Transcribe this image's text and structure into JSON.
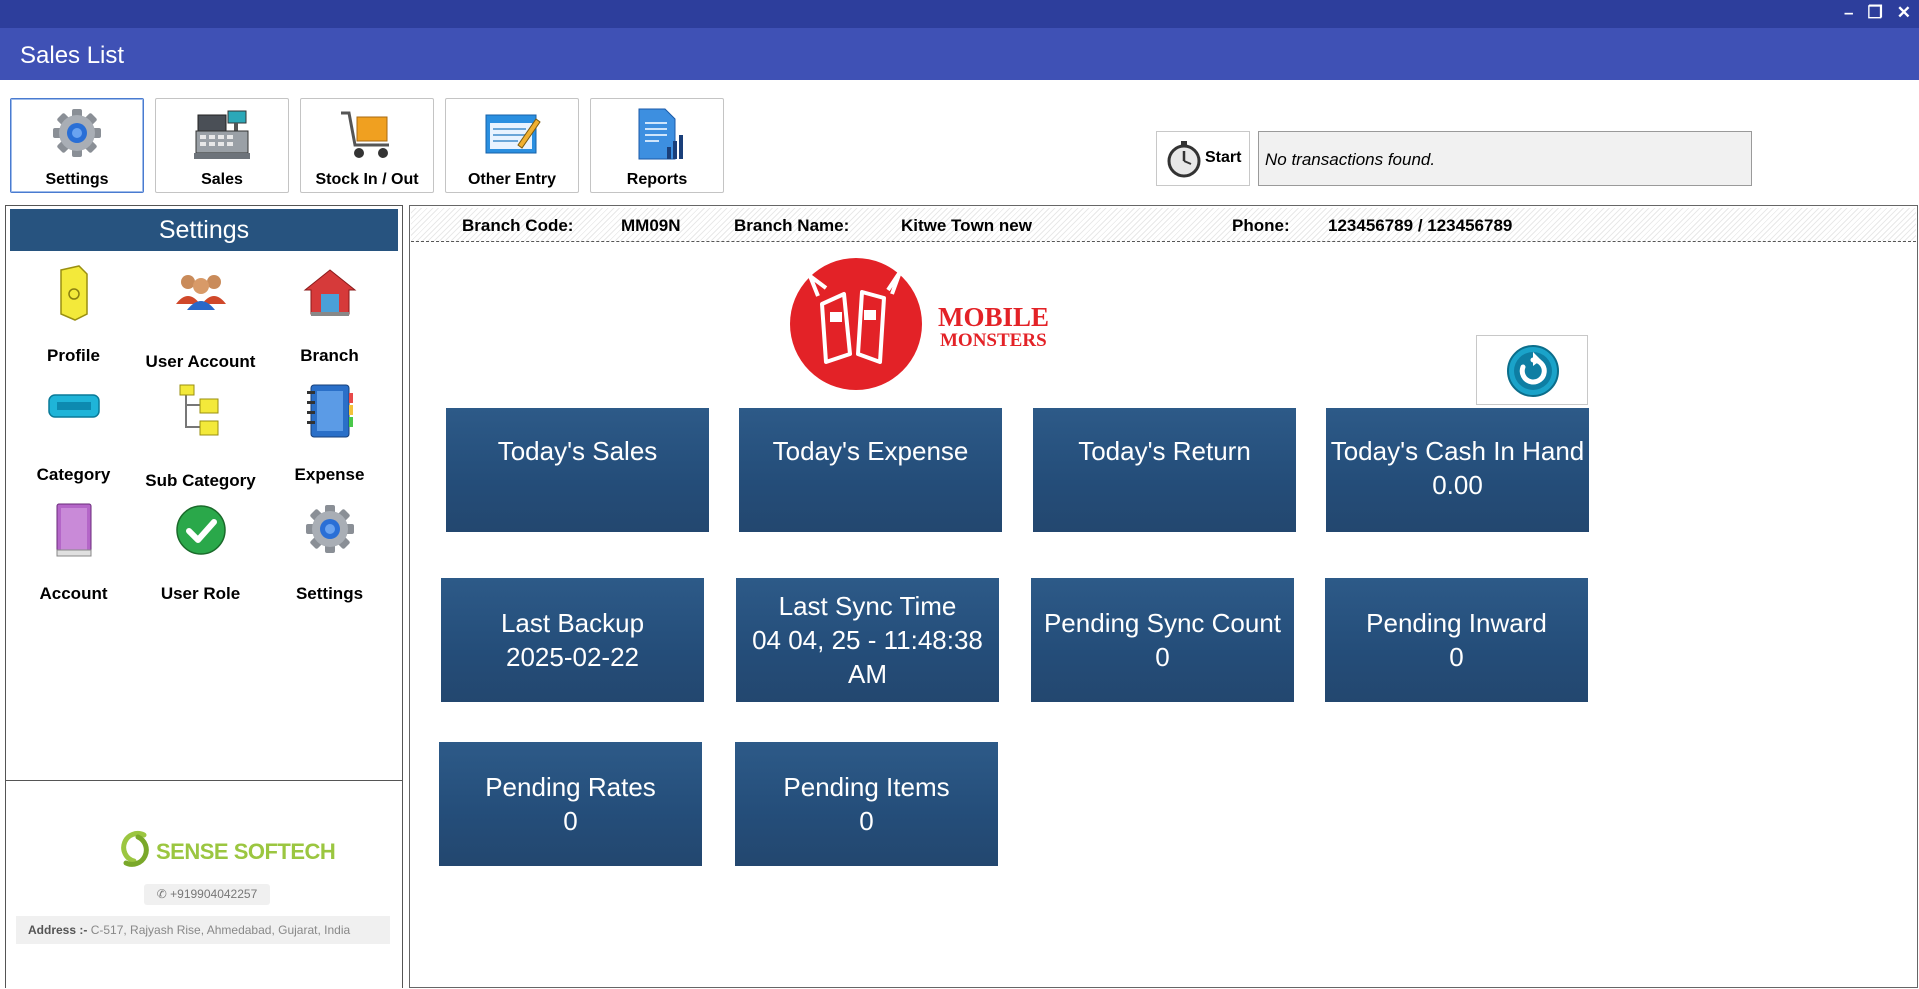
{
  "window": {
    "title": "Sales List",
    "controls": [
      "–",
      "❐",
      "✕"
    ]
  },
  "toolbar": [
    {
      "label": "Settings",
      "icon": "gear-icon",
      "active": true
    },
    {
      "label": "Sales",
      "icon": "cash-register-icon"
    },
    {
      "label": "Stock In / Out",
      "icon": "cart-icon"
    },
    {
      "label": "Other Entry",
      "icon": "notepad-icon"
    },
    {
      "label": "Reports",
      "icon": "report-icon"
    }
  ],
  "timer": {
    "label": "Start",
    "icon": "stopwatch-icon"
  },
  "status": {
    "text": "No transactions found."
  },
  "sidebar": {
    "title": "Settings",
    "items": [
      {
        "label": "Profile",
        "icon": "profile-tag-icon"
      },
      {
        "label": "User Account",
        "icon": "users-icon"
      },
      {
        "label": "Branch",
        "icon": "house-icon"
      },
      {
        "label": "Category",
        "icon": "category-icon"
      },
      {
        "label": "Sub Category",
        "icon": "folder-tree-icon"
      },
      {
        "label": "Expense",
        "icon": "notebook-icon"
      },
      {
        "label": "Account",
        "icon": "book-icon"
      },
      {
        "label": "User Role",
        "icon": "check-shield-icon"
      },
      {
        "label": "Settings",
        "icon": "gear-icon"
      }
    ]
  },
  "vendor": {
    "name": "SENSE SOFTECH",
    "phone": "+919904042257",
    "address_label": "Address :-",
    "address": "C-517, Rajyash Rise, Ahmedabad, Gujarat, India"
  },
  "branch": {
    "code_label": "Branch Code:",
    "code": "MM09N",
    "name_label": "Branch Name:",
    "name": "Kitwe Town new",
    "phone_label": "Phone:",
    "phone": "123456789 / 123456789"
  },
  "logo": {
    "line1": "MOBILE",
    "line2": "MONSTERS"
  },
  "tiles": [
    {
      "title": "Today's Sales",
      "value": ""
    },
    {
      "title": "Today's Expense",
      "value": ""
    },
    {
      "title": "Today's Return",
      "value": ""
    },
    {
      "title": "Today's Cash In Hand",
      "value": "0.00"
    },
    {
      "title": "Last Backup",
      "value": "2025-02-22"
    },
    {
      "title": "Last Sync Time",
      "value": "04 04, 25 - 11:48:38 AM"
    },
    {
      "title": "Pending Sync Count",
      "value": "0"
    },
    {
      "title": "Pending Inward",
      "value": "0"
    },
    {
      "title": "Pending Rates",
      "value": "0"
    },
    {
      "title": "Pending Items",
      "value": "0"
    }
  ],
  "colors": {
    "titlebar": "#2d3e9c",
    "header": "#3f51b5",
    "tile": "#244d79",
    "sidebar_title": "#27537f",
    "brand_red": "#e32227",
    "vendor_green": "#9bc640"
  }
}
